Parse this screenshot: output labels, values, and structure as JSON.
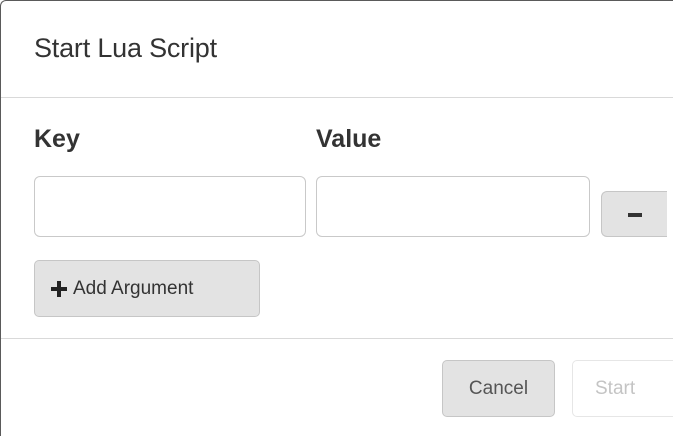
{
  "dialog": {
    "title": "Start Lua Script"
  },
  "arguments": {
    "key_header": "Key",
    "value_header": "Value",
    "rows": [
      {
        "key": "",
        "value": "",
        "remove_icon": "minus-icon"
      }
    ],
    "add_label": "Add Argument",
    "add_icon": "plus-icon"
  },
  "footer": {
    "cancel_label": "Cancel",
    "start_label": "Start",
    "start_disabled": true
  },
  "colors": {
    "button_bg": "#e3e3e3",
    "text": "#333333",
    "disabled_text": "#c4c4c4",
    "divider": "#d9d9d9"
  }
}
